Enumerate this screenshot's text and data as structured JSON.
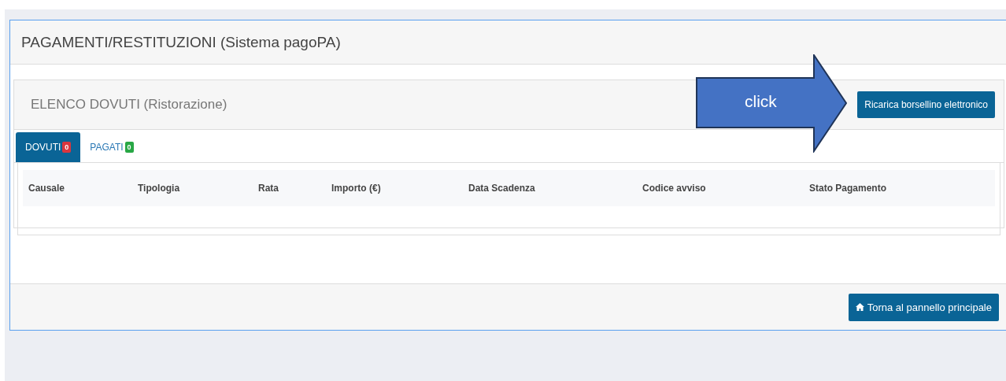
{
  "panel": {
    "title": "PAGAMENTI/RESTITUZIONI (Sistema pagoPA)"
  },
  "section": {
    "title": "ELENCO DOVUTI (Ristorazione)",
    "action": "Ricarica borsellino elettronico"
  },
  "callout": {
    "label": "click"
  },
  "tabs": [
    {
      "label": "DOVUTI",
      "count": "0",
      "color": "#d9363e",
      "selected": true
    },
    {
      "label": "PAGATI",
      "count": "0",
      "color": "#28a745",
      "selected": false
    }
  ],
  "table": {
    "columns": [
      "Causale",
      "Tipologia",
      "Rata",
      "Importo (€)",
      "Data Scadenza",
      "Codice avviso",
      "Stato Pagamento"
    ]
  },
  "footer": {
    "button": "Torna al pannello principale"
  }
}
